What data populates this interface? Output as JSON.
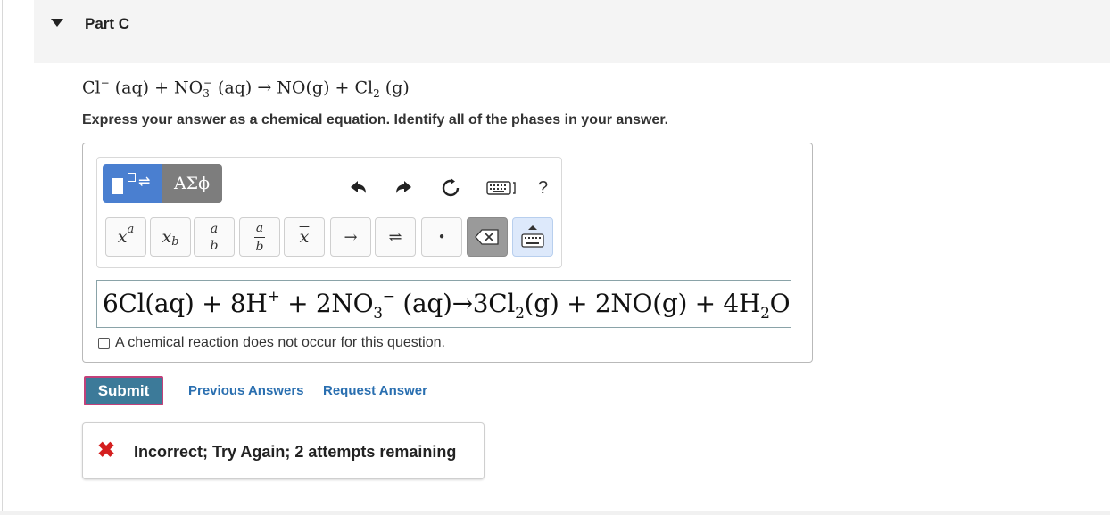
{
  "part": {
    "title": "Part C"
  },
  "question": {
    "equation": {
      "cl": "Cl",
      "cl_charge": "−",
      "cl_phase": " (aq) + NO",
      "no3_sub": "3",
      "no3_sup": "−",
      "rest": " (aq) → NO(g) + Cl",
      "cl2_sub": "2",
      "cl2_phase": " (g)"
    },
    "instructions": "Express your answer as a chemical equation. Identify all of the phases in your answer."
  },
  "toolbar": {
    "greek_label": "ΑΣϕ",
    "help_label": "?",
    "keys": {
      "superscript": {
        "base": "x",
        "script": "a"
      },
      "subscript": {
        "base": "x",
        "script": "b"
      },
      "fraction_top": "a",
      "fraction_bottom": "b",
      "mixed_top": "a",
      "mixed_bottom": "b",
      "xbar": "x",
      "arrow": "→",
      "equilibrium": "⇌",
      "dot": "•"
    },
    "icons": [
      "template-icon",
      "undo-icon",
      "redo-icon",
      "reset-icon",
      "keyboard-icon",
      "help-icon",
      "delete-icon",
      "keyboard-toggle-icon"
    ]
  },
  "answer": {
    "p1": "6Cl(aq) + 8H",
    "p1_sup": "+",
    "p2": " + 2NO",
    "p2_sub": "3",
    "p2_sup": "−",
    "p3": " (aq)→3Cl",
    "p3_sub": "2",
    "p4": "(g) + 2NO(g) + 4H",
    "p4_sub": "2",
    "p5": "O"
  },
  "no_reaction": {
    "label": "A chemical reaction does not occur for this question.",
    "checked": false
  },
  "actions": {
    "submit_label": "Submit",
    "previous_answers_label": "Previous Answers",
    "request_answer_label": "Request Answer"
  },
  "feedback": {
    "icon": "✖",
    "text": "Incorrect; Try Again; 2 attempts remaining",
    "color": "#d41f1f"
  },
  "colors": {
    "submit": "#3c7a99",
    "link": "#2a6fb0",
    "template_button": "#4a7fd0"
  }
}
